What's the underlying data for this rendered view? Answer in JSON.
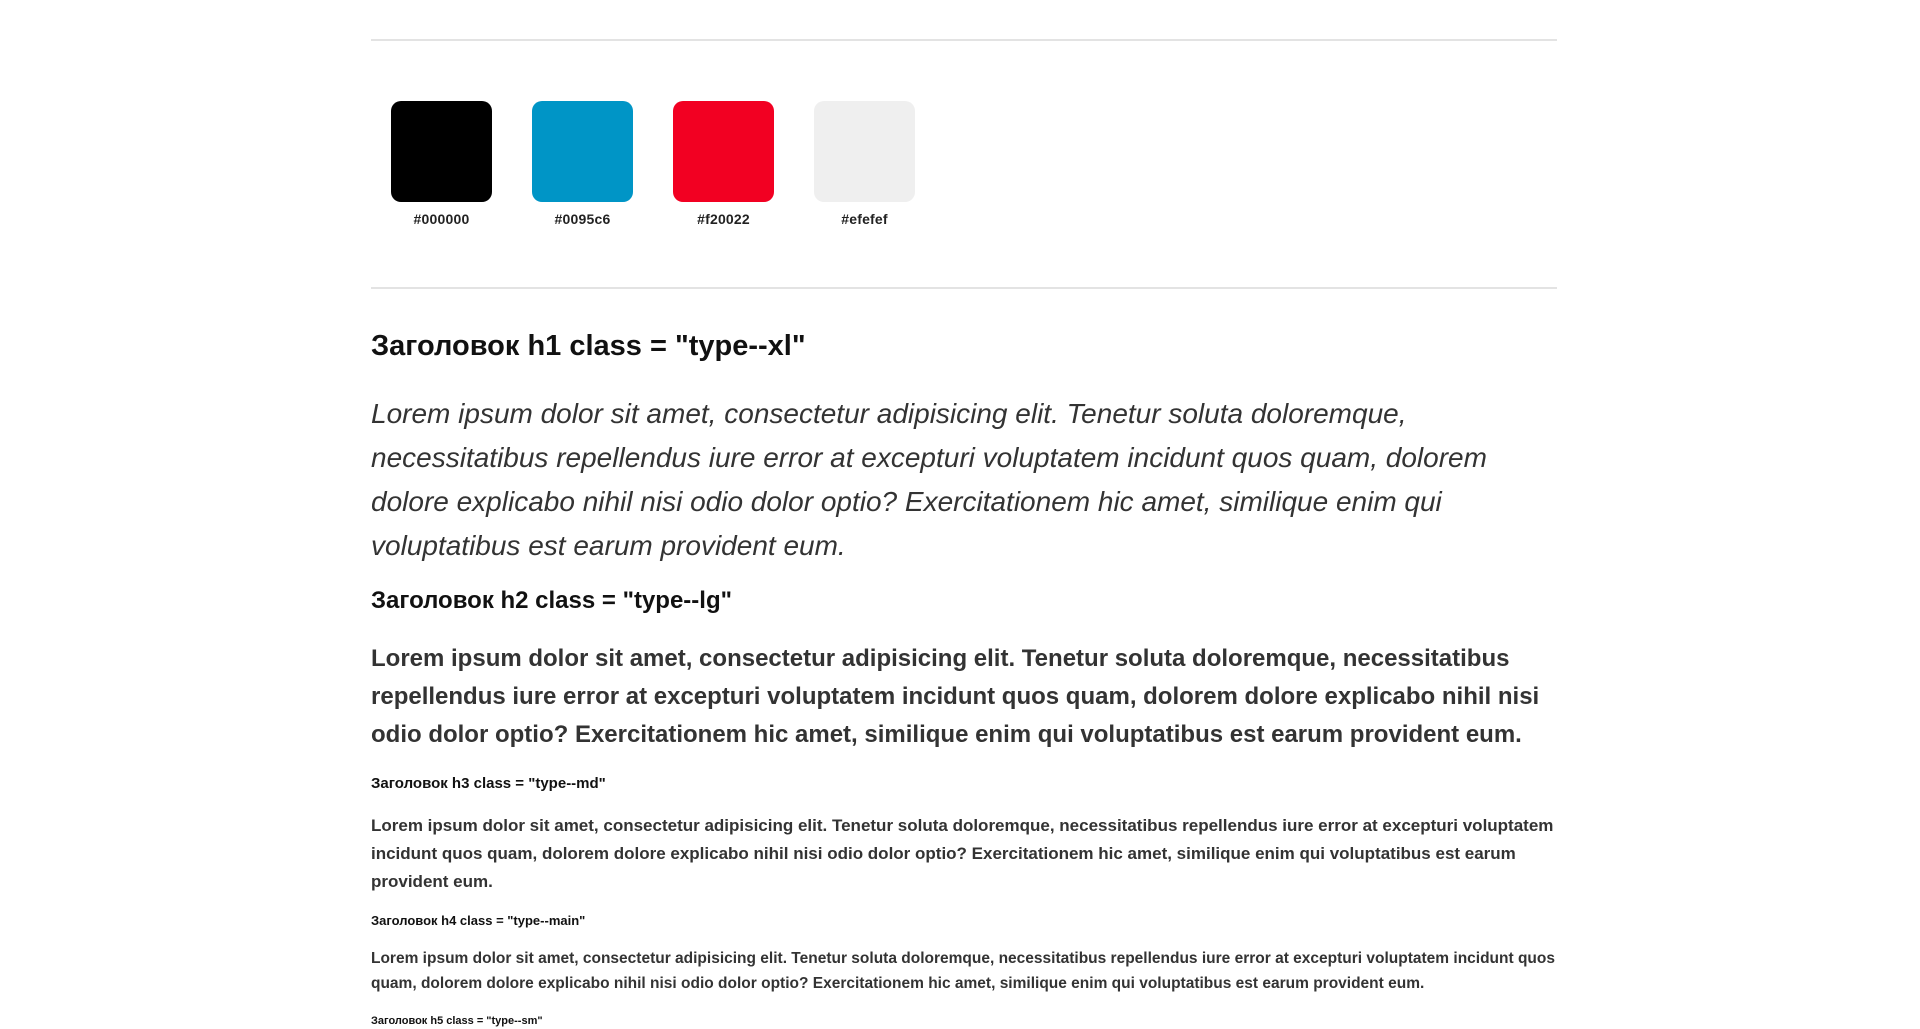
{
  "colors": {
    "swatches": [
      {
        "hex": "#000000",
        "label": "#000000"
      },
      {
        "hex": "#0095c6",
        "label": "#0095c6"
      },
      {
        "hex": "#f20022",
        "label": "#f20022"
      },
      {
        "hex": "#efefef",
        "label": "#efefef"
      }
    ]
  },
  "typography": {
    "h1": "Заголовок h1 class = \"type--xl\"",
    "p_xl": "Lorem ipsum dolor sit amet, consectetur adipisicing elit. Tenetur soluta doloremque, necessitatibus repellendus iure error at excepturi voluptatem incidunt quos quam, dolorem dolore explicabo nihil nisi odio dolor optio? Exercitationem hic amet, similique enim qui voluptatibus est earum provident eum.",
    "h2": "Заголовок h2 class = \"type--lg\"",
    "p_lg": "Lorem ipsum dolor sit amet, consectetur adipisicing elit. Tenetur soluta doloremque, necessitatibus repellendus iure error at excepturi voluptatem incidunt quos quam, dolorem dolore explicabo nihil nisi odio dolor optio? Exercitationem hic amet, similique enim qui voluptatibus est earum provident eum.",
    "h3": "Заголовок h3 class = \"type--md\"",
    "p_md": "Lorem ipsum dolor sit amet, consectetur adipisicing elit. Tenetur soluta doloremque, necessitatibus repellendus iure error at excepturi voluptatem incidunt quos quam, dolorem dolore explicabo nihil nisi odio dolor optio? Exercitationem hic amet, similique enim qui voluptatibus est earum provident eum.",
    "h4": "Заголовок h4 class = \"type--main\"",
    "p_main": "Lorem ipsum dolor sit amet, consectetur adipisicing elit. Tenetur soluta doloremque, necessitatibus repellendus iure error at excepturi voluptatem incidunt quos quam, dolorem dolore explicabo nihil nisi odio dolor optio? Exercitationem hic amet, similique enim qui voluptatibus est earum provident eum.",
    "h5": "Заголовок h5 class = \"type--sm\""
  }
}
